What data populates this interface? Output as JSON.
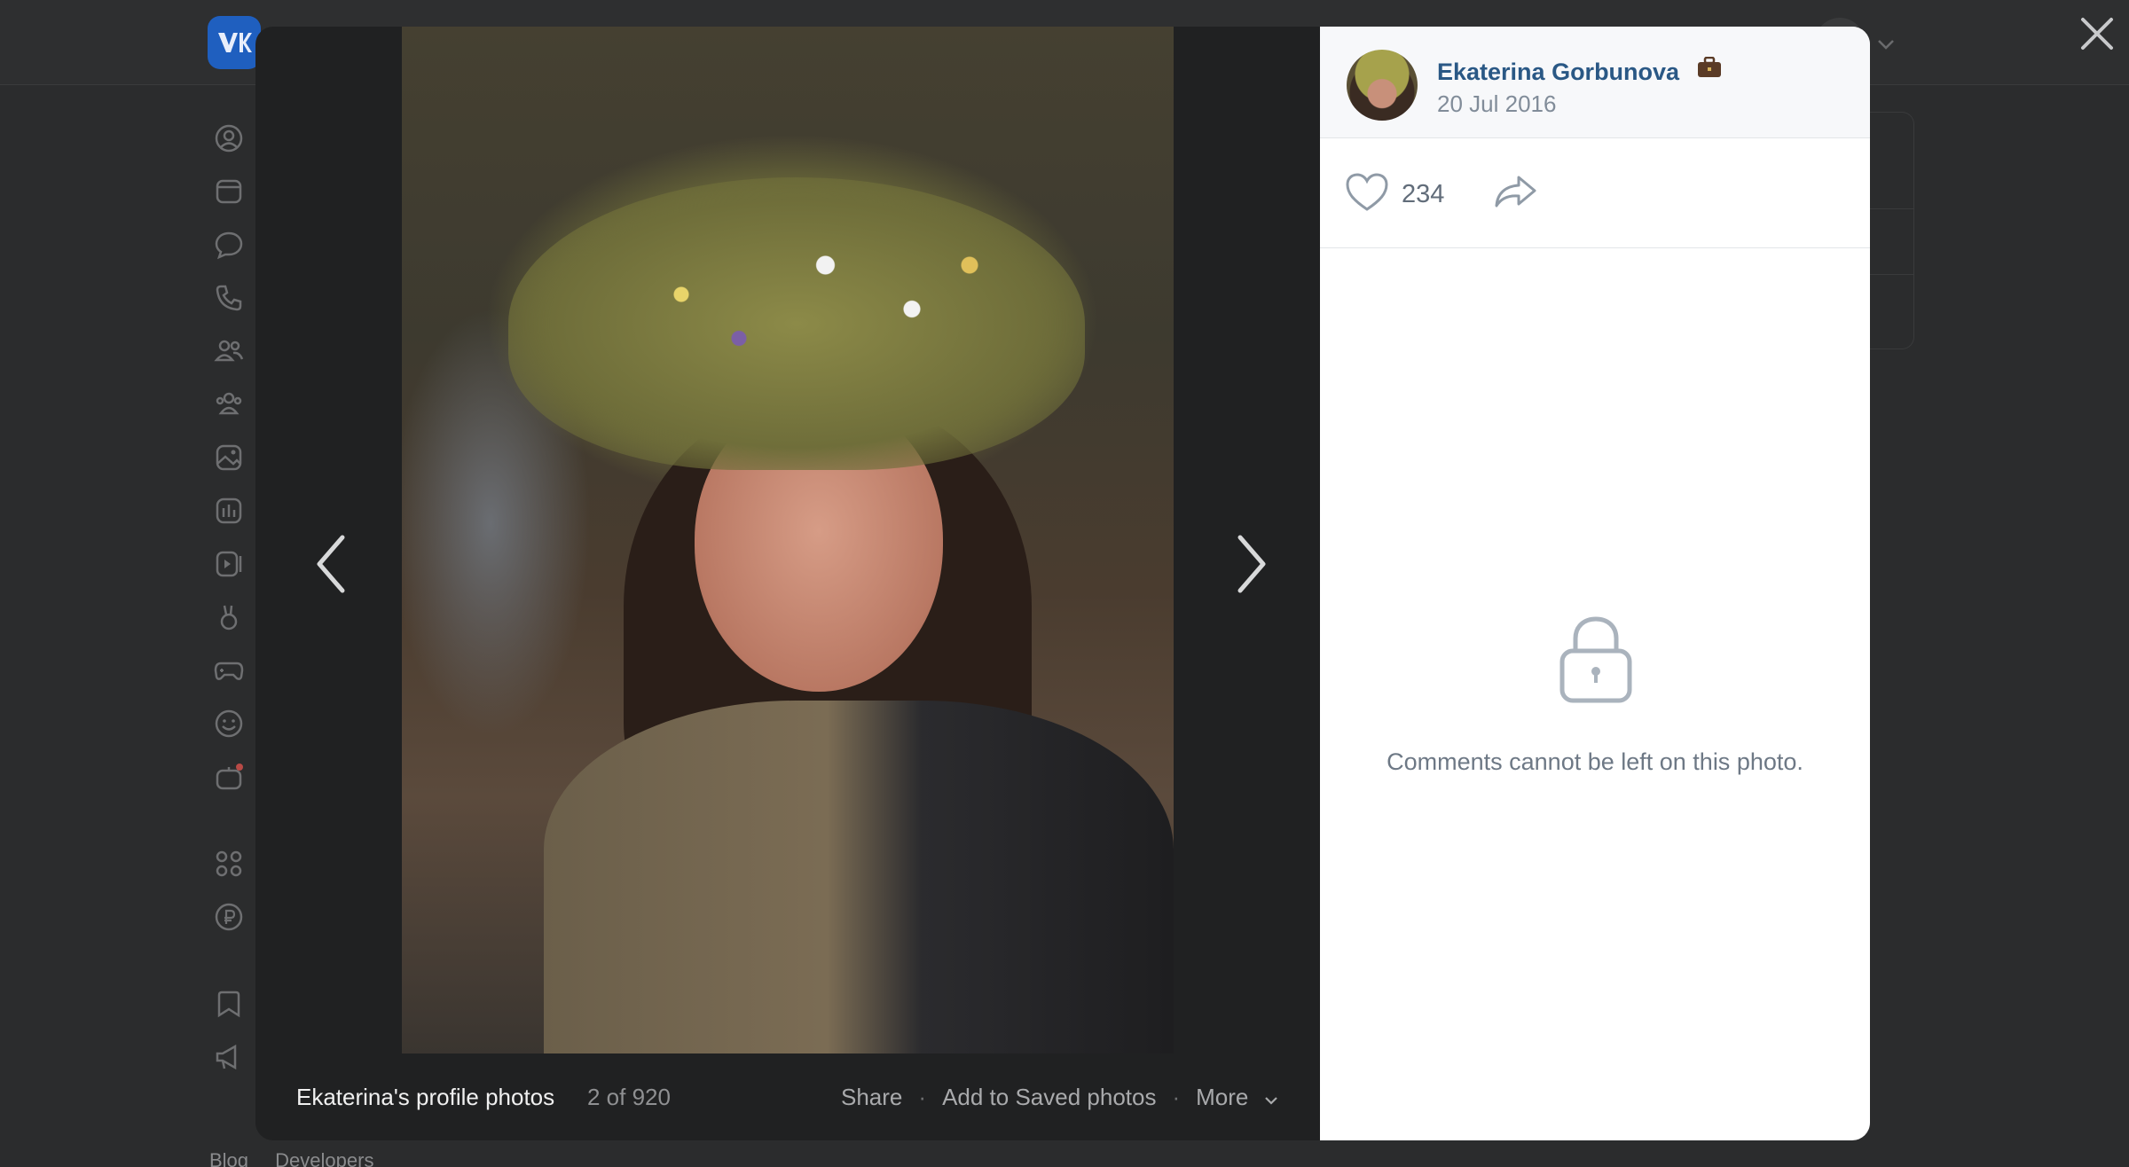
{
  "colors": {
    "link": "#2a5885",
    "muted": "#818c99",
    "overlay": "#202122",
    "panel": "#ffffff",
    "accent": "#1f5fbf"
  },
  "background_page": {
    "logo_icon": "vk-logo-icon",
    "sidebar_icons": [
      "profile-icon",
      "news-icon",
      "messenger-icon",
      "calls-icon",
      "friends-icon",
      "communities-icon",
      "photos-icon",
      "music-icon",
      "video-icon",
      "clips-icon",
      "games-icon",
      "stickers-icon",
      "gifts-icon",
      "apps-icon",
      "payments-icon",
      "bookmarks-icon",
      "ads-icon"
    ],
    "footer_links": [
      "Blog",
      "Developers"
    ]
  },
  "viewer": {
    "close_icon": "close-icon",
    "prev_icon": "chevron-left-icon",
    "next_icon": "chevron-right-icon",
    "album_title": "Ekaterina's profile photos",
    "counter": "2 of 920",
    "actions": {
      "share": "Share",
      "save": "Add to Saved photos",
      "more": "More",
      "separator": "·"
    }
  },
  "sidebar": {
    "author": "Ekaterina Gorbunova",
    "author_badge_icon": "briefcase-icon",
    "date": "20 Jul 2016",
    "likes": "234",
    "like_icon": "heart-icon",
    "share_icon": "share-arrow-icon",
    "lock_icon": "lock-icon",
    "comments_disabled_text": "Comments cannot be left on this photo."
  }
}
